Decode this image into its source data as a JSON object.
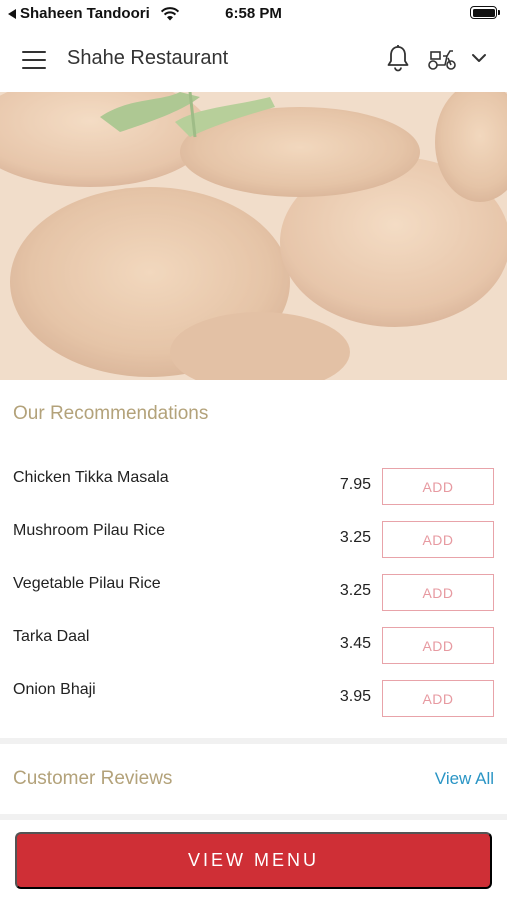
{
  "status_bar": {
    "back_app": "Shaheen Tandoori",
    "time": "6:58 PM"
  },
  "header": {
    "title": "Shahe Restaurant"
  },
  "recommendations": {
    "title": "Our Recommendations",
    "add_label": "ADD",
    "items": [
      {
        "name": "Chicken Tikka Masala",
        "price": "7.95"
      },
      {
        "name": "Mushroom Pilau Rice",
        "price": "3.25"
      },
      {
        "name": "Vegetable Pilau Rice",
        "price": "3.25"
      },
      {
        "name": "Tarka Daal",
        "price": "3.45"
      },
      {
        "name": "Onion Bhaji",
        "price": "3.95"
      }
    ]
  },
  "reviews": {
    "title": "Customer Reviews",
    "view_all": "View All"
  },
  "footer": {
    "view_menu": "VIEW MENU"
  },
  "colors": {
    "accent_red": "#cf2f36",
    "section_title": "#b3a27a",
    "link_blue": "#2a95c5",
    "add_border": "#e8a3a9"
  },
  "icons": [
    "back-arrow-icon",
    "wifi-icon",
    "battery-icon",
    "menu-icon",
    "bell-icon",
    "scooter-icon",
    "chevron-down-icon"
  ]
}
